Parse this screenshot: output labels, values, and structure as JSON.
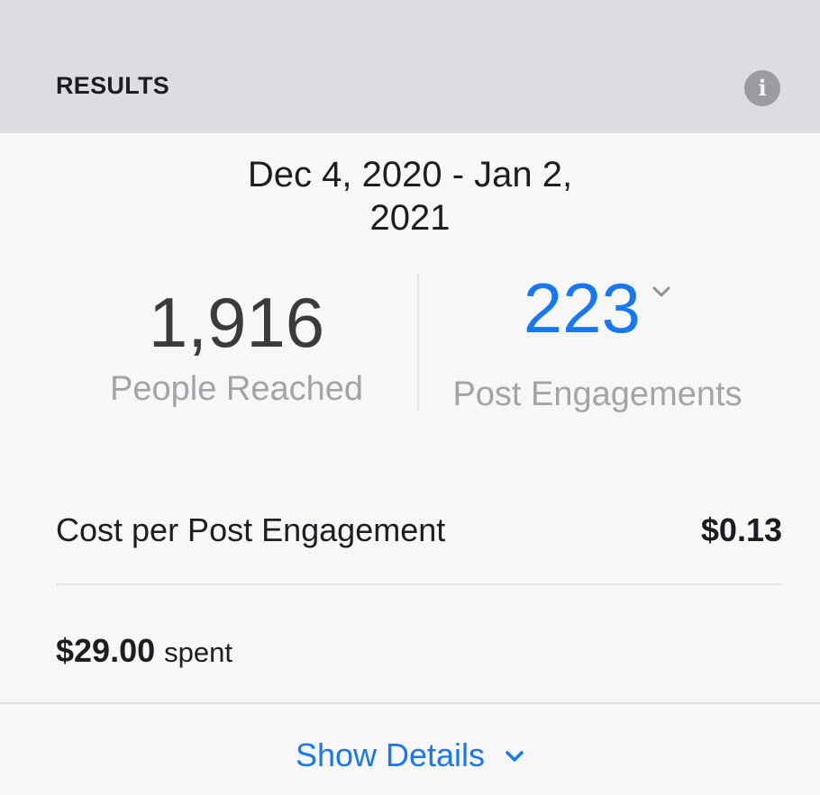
{
  "header": {
    "title": "RESULTS",
    "info_icon": "info-icon"
  },
  "results": {
    "date_range": "Dec 4, 2020 - Jan 2, 2021",
    "people_reached": {
      "value": "1,916",
      "label": "People Reached"
    },
    "post_engagements": {
      "value": "223",
      "label": "Post Engagements",
      "dropdown_icon": "chevron-down-icon"
    },
    "cost_per_engagement": {
      "label": "Cost per Post Engagement",
      "amount": "$0.13"
    },
    "spent": {
      "amount": "$29.00",
      "suffix": "spent"
    }
  },
  "footer": {
    "show_details_label": "Show Details",
    "show_details_icon": "chevron-down-icon"
  },
  "colors": {
    "header_bg": "#dcdde0",
    "card_bg": "#f7f7f8",
    "accent_blue": "#1877f2",
    "muted_text": "#a2a4a8"
  }
}
